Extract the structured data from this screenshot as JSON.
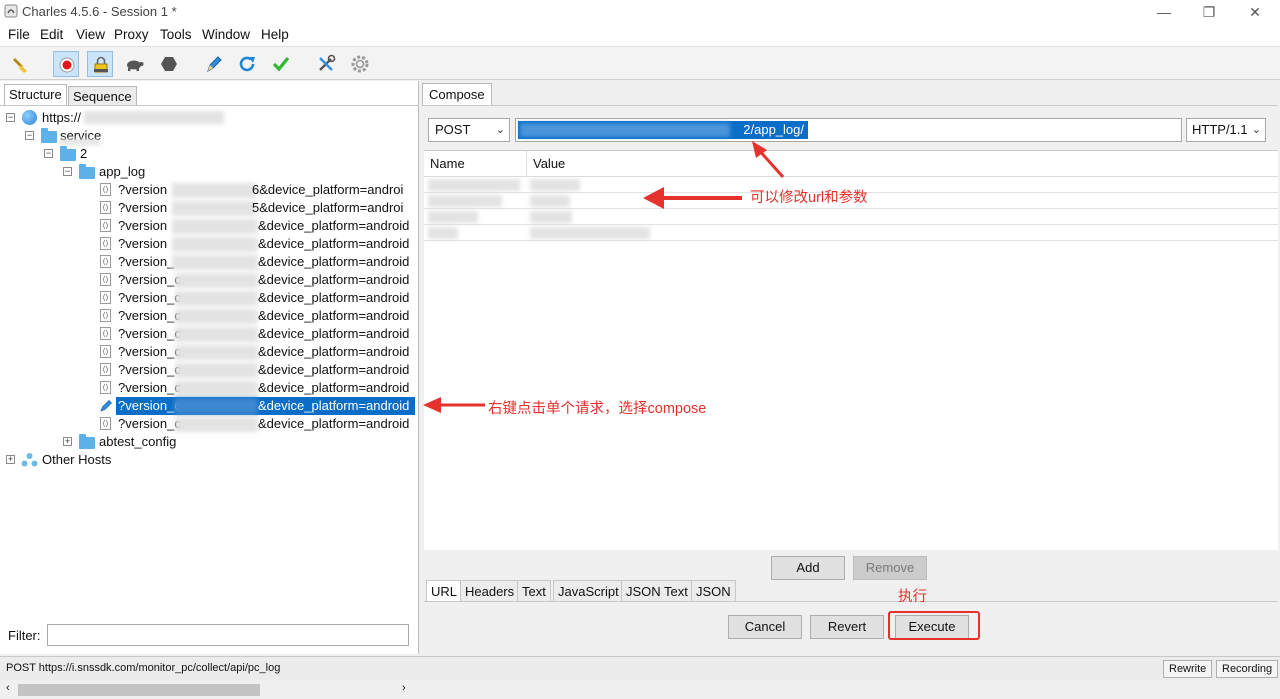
{
  "window": {
    "title": "Charles 4.5.6 - Session 1 *",
    "controls": {
      "minimize": "—",
      "maximize": "❐",
      "close": "✕"
    }
  },
  "menu": [
    "File",
    "Edit",
    "View",
    "Proxy",
    "Tools",
    "Window",
    "Help"
  ],
  "toolbar": {
    "buttons": [
      "broom-icon",
      "record-icon",
      "ssl-proxying-icon",
      "throttle-turtle-icon",
      "breakpoint-hexagon-icon",
      "compose-pen-icon",
      "repeat-icon",
      "validate-check-icon",
      "tools-icon",
      "settings-gear-icon"
    ]
  },
  "left": {
    "tabs": {
      "structure": "Structure",
      "sequence": "Sequence"
    },
    "tree": {
      "host": "https://",
      "service": "service",
      "folder_2": "2",
      "app_log": "app_log",
      "requests": [
        {
          "prefix": "?version",
          "suffix": "6&device_platform=androi"
        },
        {
          "prefix": "?version",
          "suffix": "5&device_platform=androi"
        },
        {
          "prefix": "?version",
          "suffix": "&device_platform=android"
        },
        {
          "prefix": "?version",
          "suffix": "&device_platform=android"
        },
        {
          "prefix": "?version_",
          "suffix": "&device_platform=android"
        },
        {
          "prefix": "?version_c",
          "suffix": "&device_platform=android"
        },
        {
          "prefix": "?version_c",
          "suffix": "&device_platform=android"
        },
        {
          "prefix": "?version_c",
          "suffix": "&device_platform=android"
        },
        {
          "prefix": "?version_c",
          "suffix": "&device_platform=android"
        },
        {
          "prefix": "?version_c",
          "suffix": "&device_platform=android"
        },
        {
          "prefix": "?version_c",
          "suffix": "&device_platform=android"
        },
        {
          "prefix": "?version_c",
          "suffix": "&device_platform=android"
        },
        {
          "prefix": "?version_c",
          "suffix": "&device_platform=android"
        },
        {
          "prefix": "?version_c",
          "suffix": "&device_platform=android"
        }
      ],
      "abtest": "abtest_config",
      "other_hosts": "Other Hosts"
    },
    "filter_label": "Filter:"
  },
  "compose": {
    "tab": "Compose",
    "method": "POST",
    "url_visible": "2/app_log/",
    "protocol": "HTTP/1.1",
    "columns": {
      "name": "Name",
      "value": "Value"
    },
    "add": "Add",
    "remove": "Remove",
    "body_tabs": [
      "URL",
      "Headers",
      "Text",
      "JavaScript",
      "JSON Text",
      "JSON"
    ],
    "cancel": "Cancel",
    "revert": "Revert",
    "execute": "Execute"
  },
  "annotations": {
    "url": "可以修改url和参数",
    "request": "右键点击单个请求，选择compose",
    "execute": "执行"
  },
  "status": {
    "text": "POST https://i.snssdk.com/monitor_pc/collect/api/pc_log",
    "rewrite": "Rewrite",
    "recording": "Recording"
  },
  "colors": {
    "selection": "#0a6ec8",
    "annotation": "#e5322d",
    "folder": "#5db0e8"
  }
}
